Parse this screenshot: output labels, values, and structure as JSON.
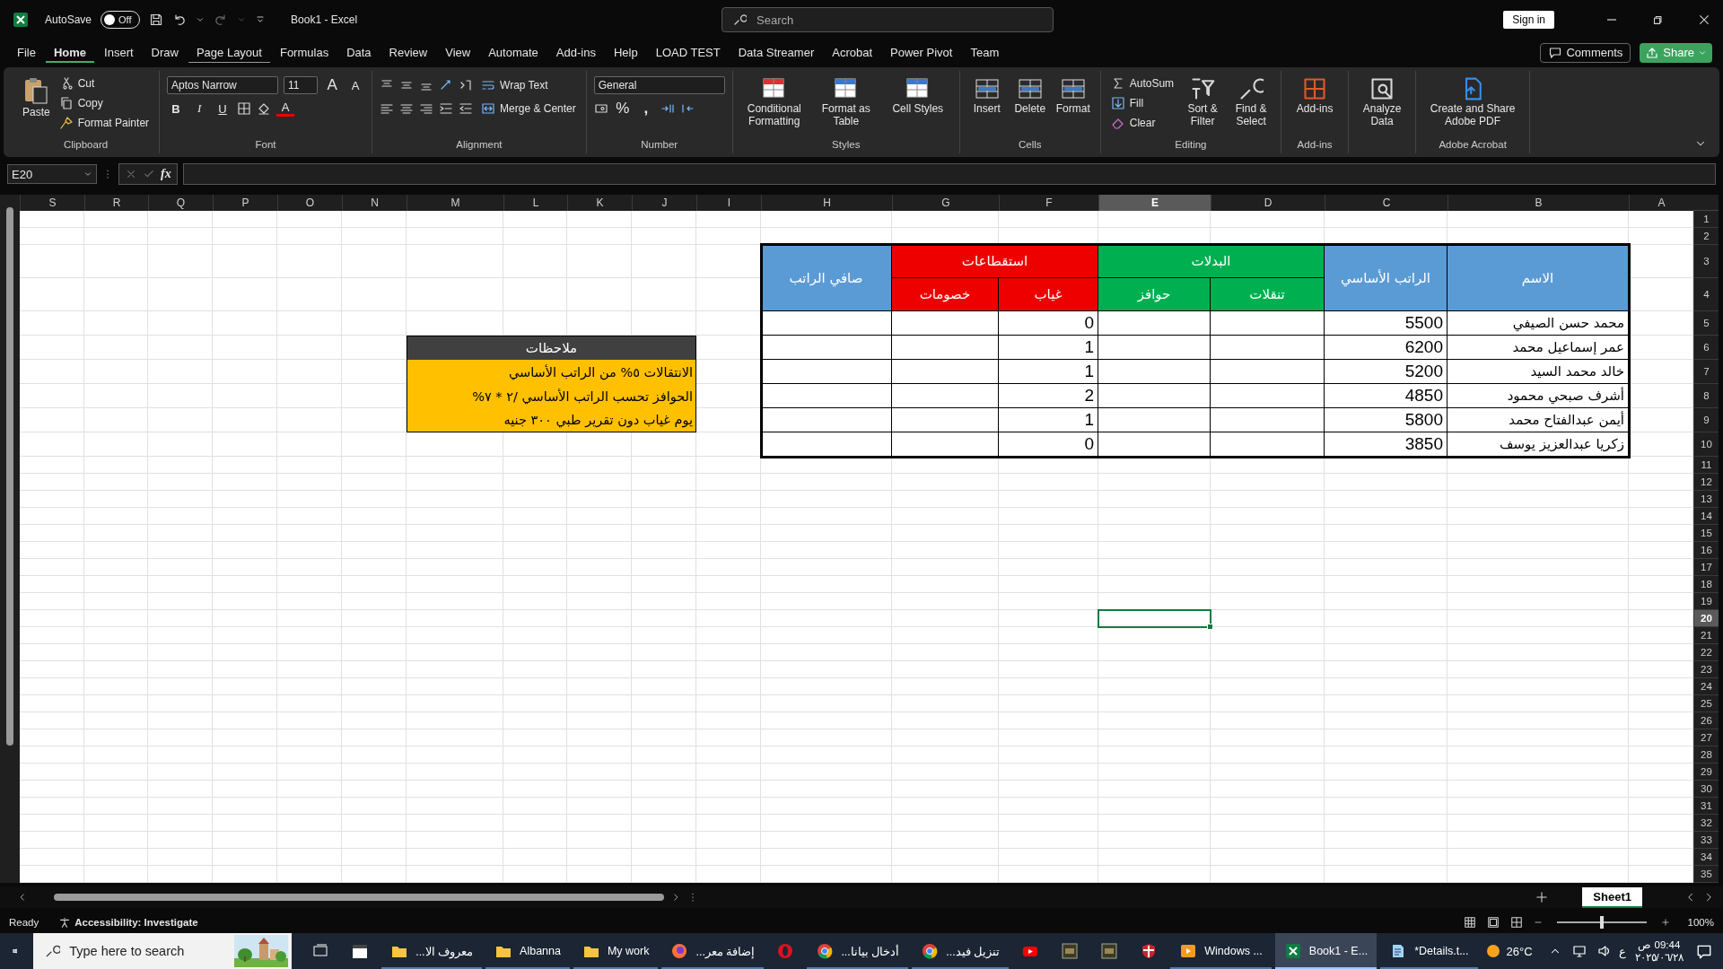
{
  "title_bar": {
    "autosave_label": "AutoSave",
    "autosave": {
      "on": false,
      "label": "Off"
    },
    "title": "Book1  -  Excel",
    "search": {
      "placeholder": "Search"
    },
    "sign_in": "Sign in"
  },
  "menu": {
    "tabs": [
      {
        "label": "File",
        "selected": false,
        "focused": false
      },
      {
        "label": "Home",
        "selected": true,
        "focused": false
      },
      {
        "label": "Insert",
        "selected": false,
        "focused": false
      },
      {
        "label": "Draw",
        "selected": false,
        "focused": false
      },
      {
        "label": "Page Layout",
        "selected": false,
        "focused": true
      },
      {
        "label": "Formulas",
        "selected": false,
        "focused": false
      },
      {
        "label": "Data",
        "selected": false,
        "focused": false
      },
      {
        "label": "Review",
        "selected": false,
        "focused": false
      },
      {
        "label": "View",
        "selected": false,
        "focused": false
      },
      {
        "label": "Automate",
        "selected": false,
        "focused": false
      },
      {
        "label": "Add-ins",
        "selected": false,
        "focused": false
      },
      {
        "label": "Help",
        "selected": false,
        "focused": false
      },
      {
        "label": "LOAD TEST",
        "selected": false,
        "focused": false
      },
      {
        "label": "Data Streamer",
        "selected": false,
        "focused": false
      },
      {
        "label": "Acrobat",
        "selected": false,
        "focused": false
      },
      {
        "label": "Power Pivot",
        "selected": false,
        "focused": false
      },
      {
        "label": "Team",
        "selected": false,
        "focused": false
      }
    ],
    "comments": "Comments",
    "share": "Share"
  },
  "ribbon": {
    "clipboard": {
      "label": "Clipboard",
      "paste": "Paste",
      "cut": "Cut",
      "copy": "Copy",
      "format_painter": "Format Painter"
    },
    "font": {
      "label": "Font",
      "family": "Aptos Narrow",
      "size": "11",
      "grow": "A",
      "shrink": "A",
      "bold": "B",
      "italic": "I",
      "underline": "U",
      "color_button": "A"
    },
    "alignment": {
      "label": "Alignment",
      "wrap": "Wrap Text",
      "merge": "Merge & Center"
    },
    "number": {
      "label": "Number",
      "format": "General",
      "percent": "%",
      "comma": ","
    },
    "styles": {
      "label": "Styles",
      "buttons": [
        "Conditional Formatting",
        "Format as Table",
        "Cell Styles"
      ]
    },
    "cells": {
      "label": "Cells",
      "buttons": [
        "Insert",
        "Delete",
        "Format"
      ]
    },
    "editing": {
      "label": "Editing",
      "autosum": "AutoSum",
      "fill": "Fill",
      "clear": "Clear",
      "sort": "Sort & Filter",
      "find": "Find & Select"
    },
    "addins": {
      "label": "Add-ins",
      "button": "Add-ins"
    },
    "analyze": {
      "button": "Analyze Data"
    },
    "acrobat": {
      "label": "Adobe Acrobat",
      "button": "Create and Share Adobe PDF"
    }
  },
  "formula_bar": {
    "name_box": "E20",
    "fx": "fx"
  },
  "sheet": {
    "columns": [
      {
        "label": "S",
        "selected": false
      },
      {
        "label": "R",
        "selected": false
      },
      {
        "label": "Q",
        "selected": false
      },
      {
        "label": "P",
        "selected": false
      },
      {
        "label": "O",
        "selected": false
      },
      {
        "label": "N",
        "selected": false
      },
      {
        "label": "M",
        "selected": false
      },
      {
        "label": "L",
        "selected": false
      },
      {
        "label": "K",
        "selected": false
      },
      {
        "label": "J",
        "selected": false
      },
      {
        "label": "I",
        "selected": false
      },
      {
        "label": "H",
        "selected": false
      },
      {
        "label": "G",
        "selected": false
      },
      {
        "label": "F",
        "selected": false
      },
      {
        "label": "E",
        "selected": true
      },
      {
        "label": "D",
        "selected": false
      },
      {
        "label": "C",
        "selected": false
      },
      {
        "label": "B",
        "selected": false
      },
      {
        "label": "A",
        "selected": false
      }
    ],
    "rows": [
      {
        "label": "1",
        "selected": false
      },
      {
        "label": "2",
        "selected": false
      },
      {
        "label": "3",
        "selected": false
      },
      {
        "label": "4",
        "selected": false
      },
      {
        "label": "5",
        "selected": false
      },
      {
        "label": "6",
        "selected": false
      },
      {
        "label": "7",
        "selected": false
      },
      {
        "label": "8",
        "selected": false
      },
      {
        "label": "9",
        "selected": false
      },
      {
        "label": "10",
        "selected": false
      },
      {
        "label": "11",
        "selected": false
      },
      {
        "label": "12",
        "selected": false
      },
      {
        "label": "13",
        "selected": false
      },
      {
        "label": "14",
        "selected": false
      },
      {
        "label": "15",
        "selected": false
      },
      {
        "label": "16",
        "selected": false
      },
      {
        "label": "17",
        "selected": false
      },
      {
        "label": "18",
        "selected": false
      },
      {
        "label": "19",
        "selected": false
      },
      {
        "label": "20",
        "selected": true
      },
      {
        "label": "21",
        "selected": false
      },
      {
        "label": "22",
        "selected": false
      },
      {
        "label": "23",
        "selected": false
      },
      {
        "label": "24",
        "selected": false
      },
      {
        "label": "25",
        "selected": false
      },
      {
        "label": "26",
        "selected": false
      },
      {
        "label": "27",
        "selected": false
      },
      {
        "label": "28",
        "selected": false
      },
      {
        "label": "29",
        "selected": false
      },
      {
        "label": "30",
        "selected": false
      },
      {
        "label": "31",
        "selected": false
      },
      {
        "label": "32",
        "selected": false
      },
      {
        "label": "33",
        "selected": false
      },
      {
        "label": "34",
        "selected": false
      },
      {
        "label": "35",
        "selected": false
      }
    ]
  },
  "table": {
    "headers": [
      {
        "label": "الاسم",
        "color": "#5b9bd5"
      },
      {
        "label": "الراتب الأساسي",
        "color": "#5b9bd5"
      },
      {
        "label": "البدلات",
        "color": "#00b050",
        "children": [
          "تنقلات",
          "حوافز"
        ]
      },
      {
        "label": "استقطاعات",
        "color": "#ee0000",
        "children": [
          "غياب",
          "خصومات"
        ]
      },
      {
        "label": "صافي الراتب",
        "color": "#5b9bd5"
      }
    ],
    "rows": [
      {
        "name": "محمد حسن الصيفي",
        "salary": "5500",
        "absence": "0"
      },
      {
        "name": "عمر إسماعيل محمد",
        "salary": "6200",
        "absence": "1"
      },
      {
        "name": "خالد محمد السيد",
        "salary": "5200",
        "absence": "1"
      },
      {
        "name": "أشرف صبحي محمود",
        "salary": "4850",
        "absence": "2"
      },
      {
        "name": "أيمن عبدالفتاح محمد",
        "salary": "5800",
        "absence": "1"
      },
      {
        "name": "زكريا عبدالعزيز يوسف",
        "salary": "3850",
        "absence": "0"
      }
    ]
  },
  "notes": {
    "title": "ملاحظات",
    "lines": [
      "الانتقالات ٥% من الراتب الأساسي",
      "الحوافز تحسب  الراتب الأساسي /٢ * ٧%",
      "يوم غياب دون تقرير طبي ٣٠٠ جنيه"
    ]
  },
  "sheet_tabs": [
    {
      "label": "Sheet1",
      "selected": true
    }
  ],
  "status_bar": {
    "ready": "Ready",
    "accessibility": "Accessibility: Investigate",
    "zoom": {
      "label": "100%",
      "level": 0.5
    }
  },
  "taskbar": {
    "search": {
      "placeholder": "Type here to search"
    },
    "apps": [
      {
        "kind": "taskview",
        "selected": false
      },
      {
        "kind": "calendar",
        "selected": false
      },
      {
        "kind": "folder",
        "label": "معروف الا...",
        "selected": false
      },
      {
        "kind": "folder",
        "label": "Albanna",
        "selected": false
      },
      {
        "kind": "folder",
        "label": "My work",
        "selected": false
      },
      {
        "kind": "firefox",
        "label": "إضافة معر...",
        "selected": false
      },
      {
        "kind": "opera",
        "selected": false
      },
      {
        "kind": "chrome",
        "label": "أدخال بيانا...",
        "selected": false
      },
      {
        "kind": "chrome",
        "label": "تنزيل فيد...",
        "selected": false
      },
      {
        "kind": "youtube",
        "selected": false
      },
      {
        "kind": "tile",
        "selected": false
      },
      {
        "kind": "tile",
        "selected": false
      },
      {
        "kind": "shield",
        "selected": false
      },
      {
        "kind": "media",
        "label": "Windows ...",
        "selected": false
      },
      {
        "kind": "excel",
        "label": "Book1 - E...",
        "selected": true
      },
      {
        "kind": "notepad",
        "label": "*Details.t...",
        "selected": false
      }
    ],
    "weather": "26°C",
    "language": "ع",
    "time": "09:44 ص",
    "date": "٢٠٢٥/٠٦/٢٨"
  }
}
